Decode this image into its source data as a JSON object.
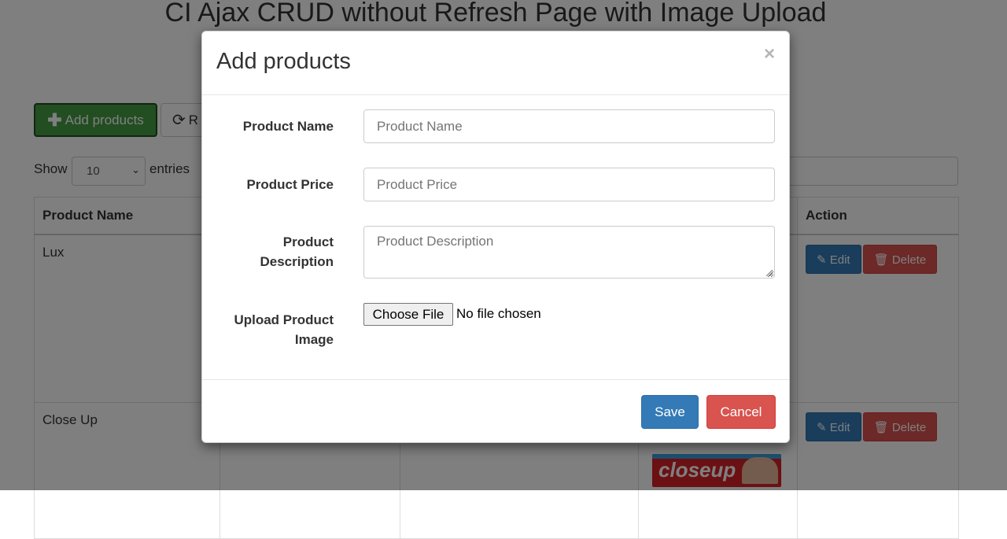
{
  "page": {
    "title": "CI Ajax CRUD without Refresh Page with Image Upload",
    "add_button": "Add products",
    "reload_button": "R"
  },
  "table_controls": {
    "show_label": "Show",
    "page_length": "10",
    "entries_label": "entries"
  },
  "table": {
    "columns": [
      "Product Name",
      "",
      "",
      "",
      "Action"
    ],
    "rows": [
      {
        "name": "Lux",
        "edit_label": "Edit",
        "delete_label": "Delete"
      },
      {
        "name": "Close Up",
        "edit_label": "Edit",
        "delete_label": "Delete",
        "image_text": "closeup"
      }
    ]
  },
  "modal": {
    "title": "Add products",
    "close_symbol": "×",
    "fields": {
      "name": {
        "label": "Product Name",
        "placeholder": "Product Name",
        "value": ""
      },
      "price": {
        "label": "Product Price",
        "placeholder": "Product Price",
        "value": ""
      },
      "description": {
        "label_line1": "Product",
        "label_line2": "Description",
        "placeholder": "Product Description",
        "value": ""
      },
      "image": {
        "label_line1": "Upload Product",
        "label_line2": "Image",
        "button": "Choose File",
        "status": "No file chosen"
      }
    },
    "save_label": "Save",
    "cancel_label": "Cancel"
  },
  "colors": {
    "overlay": "rgba(0,0,0,0.5)",
    "primary": "#337ab7",
    "danger": "#d9534f",
    "success": "#449d44"
  }
}
